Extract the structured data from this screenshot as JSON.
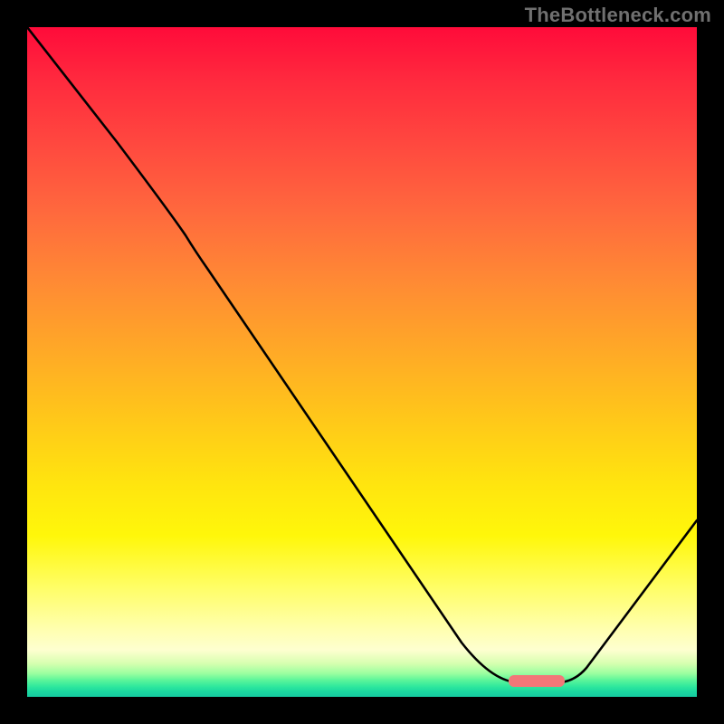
{
  "watermark": "TheBottleneck.com",
  "colors": {
    "background": "#000000",
    "curve": "#000000",
    "marker": "#f27878",
    "gradient_top": "#ff0b3a",
    "gradient_bottom": "#16caa0",
    "watermark_text": "#707070"
  },
  "chart_data": {
    "type": "line",
    "title": "",
    "xlabel": "",
    "ylabel": "",
    "xlim": [
      0,
      100
    ],
    "ylim": [
      0,
      100
    ],
    "grid": false,
    "legend": false,
    "series": [
      {
        "name": "bottleneck-curve",
        "x": [
          0,
          13.5,
          23.6,
          27.0,
          64.9,
          73.0,
          79.7,
          83.5,
          100
        ],
        "values": [
          100,
          82.7,
          68.9,
          63.8,
          8.1,
          2.2,
          2.2,
          4.3,
          26.4
        ]
      }
    ],
    "annotations": [
      {
        "name": "optimal-range-marker",
        "x_start": 71.9,
        "x_end": 80.3,
        "y": 2.3,
        "color": "#f27878"
      }
    ],
    "background_gradient": {
      "direction": "vertical",
      "stops": [
        {
          "pos": 0.0,
          "color": "#ff0b3a"
        },
        {
          "pos": 0.28,
          "color": "#ff6a3d"
        },
        {
          "pos": 0.58,
          "color": "#ffc61a"
        },
        {
          "pos": 0.84,
          "color": "#fffe6a"
        },
        {
          "pos": 0.95,
          "color": "#d7ffb0"
        },
        {
          "pos": 1.0,
          "color": "#16caa0"
        }
      ]
    }
  }
}
